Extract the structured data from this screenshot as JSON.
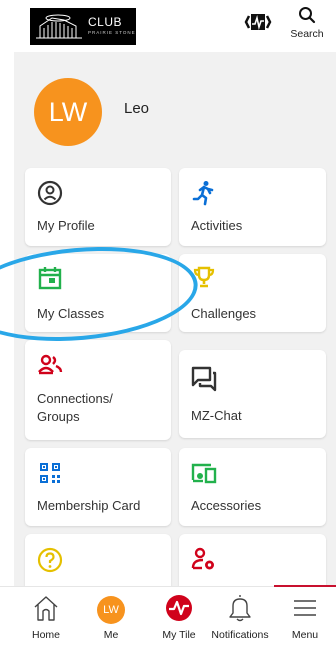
{
  "header": {
    "logo_text": "CLUB",
    "logo_subtext": "PRAIRIE STONE",
    "search_label": "Search"
  },
  "profile": {
    "initials": "LW",
    "name": "Leo"
  },
  "tiles": [
    {
      "label": "My Profile",
      "icon": "user-circle-icon"
    },
    {
      "label": "Activities",
      "icon": "running-person-icon"
    },
    {
      "label": "My Classes",
      "icon": "calendar-icon"
    },
    {
      "label": "Challenges",
      "icon": "trophy-icon"
    },
    {
      "label": "Connections/ Groups",
      "icon": "people-icon"
    },
    {
      "label": "MZ-Chat",
      "icon": "chat-icon"
    },
    {
      "label": "Membership Card",
      "icon": "qr-code-icon"
    },
    {
      "label": "Accessories",
      "icon": "devices-icon"
    },
    {
      "label": "",
      "icon": "help-icon"
    },
    {
      "label": "",
      "icon": "user-settings-icon"
    }
  ],
  "nav": {
    "home": "Home",
    "me": "Me",
    "me_initials": "LW",
    "mytile": "My Tile",
    "notifications": "Notifications",
    "menu": "Menu"
  },
  "colors": {
    "avatar": "#f7931e",
    "menu_active": "#c8102e",
    "activities": "#0a6fd6",
    "classes": "#22b14c",
    "challenges": "#e5c000",
    "connections": "#d0021b",
    "membership": "#0a6fd6",
    "accessories": "#22b14c",
    "help": "#e5c000",
    "highlight": "#29a7e8"
  }
}
